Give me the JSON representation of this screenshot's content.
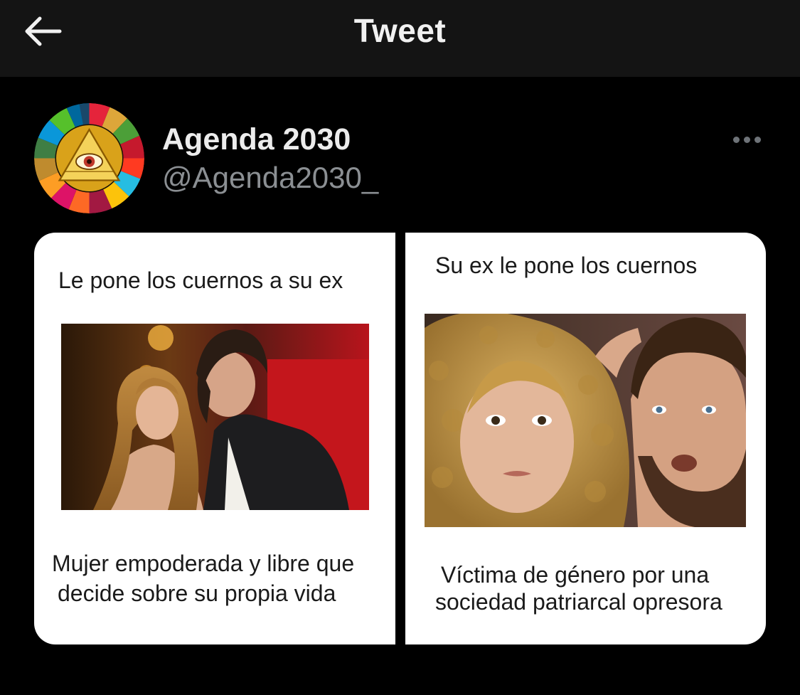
{
  "header": {
    "title": "Tweet",
    "back_icon": "arrow-left-icon"
  },
  "author": {
    "display_name": "Agenda 2030",
    "handle": "@Agenda2030_",
    "avatar_icon": "all-seeing-eye-sdg-wheel-logo",
    "more_icon": "more-horizontal-icon"
  },
  "meme": {
    "left": {
      "top_caption": "Le pone los cuernos a su ex",
      "bottom_caption_line1": "Mujer empoderada y libre que",
      "bottom_caption_line2": "decide sobre su propia vida"
    },
    "right": {
      "top_caption": "Su ex le pone los cuernos",
      "bottom_caption_line1": "Víctima de género por una",
      "bottom_caption_line2": "sociedad patriarcal opresora"
    }
  },
  "colors": {
    "background": "#000000",
    "header_bg": "#141414",
    "text_primary": "#ececec",
    "text_secondary": "#8b8f93"
  }
}
